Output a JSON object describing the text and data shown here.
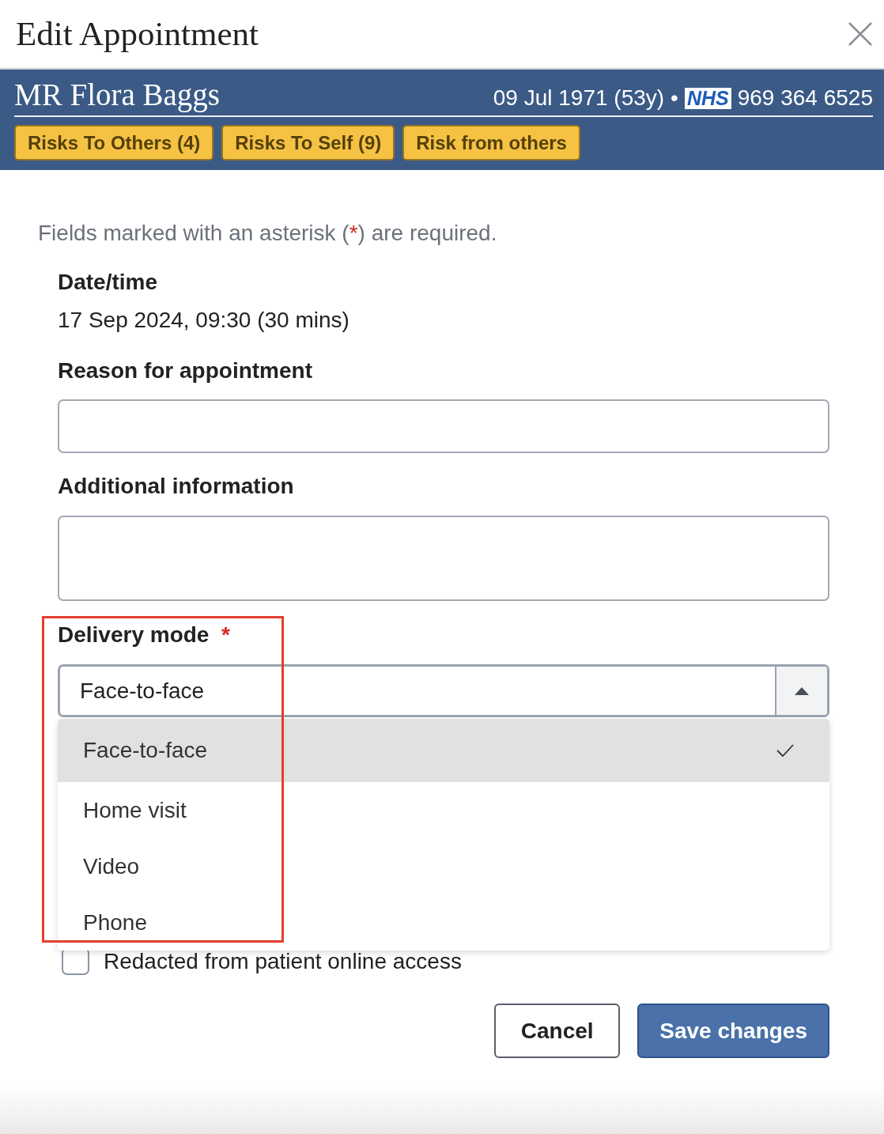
{
  "dialog": {
    "title": "Edit Appointment"
  },
  "patient": {
    "name": "MR Flora Baggs",
    "dob": "09 Jul 1971 (53y)",
    "separator": "•",
    "id_label": "NHS",
    "id_number": "969 364 6525"
  },
  "risk_badges": [
    "Risks To Others (4)",
    "Risks To Self (9)",
    "Risk from others"
  ],
  "form": {
    "required_note": {
      "before": "Fields marked with an asterisk (",
      "mark": "*",
      "after": ") are required."
    },
    "date_time": {
      "label": "Date/time",
      "value": "17 Sep 2024, 09:30 (30 mins)"
    },
    "fields": [
      {
        "kind": "text",
        "label": "Reason for appointment",
        "required": false
      },
      {
        "kind": "textarea",
        "label": "Additional information",
        "required": false
      },
      {
        "kind": "select",
        "label": "Delivery mode",
        "required": true,
        "required_mark": "*",
        "value": "Face-to-face",
        "expanded": true,
        "options": [
          {
            "label": "Face-to-face",
            "selected": true
          },
          {
            "label": "Home visit",
            "selected": false
          },
          {
            "label": "Video",
            "selected": false
          },
          {
            "label": "Phone",
            "selected": false
          }
        ]
      }
    ],
    "checkbox": {
      "label": "Redacted from patient online access",
      "checked": false
    }
  },
  "buttons": [
    {
      "kind": "secondary",
      "label": "Cancel"
    },
    {
      "kind": "primary",
      "label": "Save changes"
    }
  ]
}
